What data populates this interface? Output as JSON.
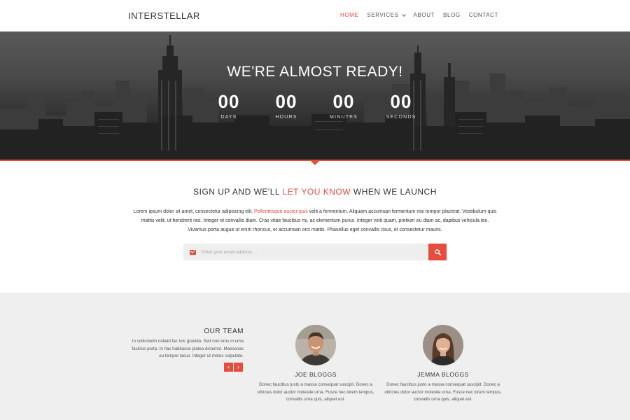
{
  "nav": {
    "brand": "INTERSTELLAR",
    "items": [
      {
        "label": "HOME",
        "active": true
      },
      {
        "label": "SERVICES",
        "has_dropdown": true
      },
      {
        "label": "ABOUT"
      },
      {
        "label": "BLOG"
      },
      {
        "label": "CONTACT"
      }
    ]
  },
  "hero": {
    "title": "WE'RE ALMOST READY!",
    "countdown": [
      {
        "value": "00",
        "label": "DAYS"
      },
      {
        "value": "00",
        "label": "HOURS"
      },
      {
        "value": "00",
        "label": "MINUTES"
      },
      {
        "value": "00",
        "label": "SECONDS"
      }
    ]
  },
  "signup": {
    "heading_before": "SIGN UP AND WE'LL ",
    "heading_highlight": "LET YOU KNOW",
    "heading_after": " WHEN WE LAUNCH",
    "body_before": "Lorem ipsum dolor sit amet, consectetur adipiscing elit. ",
    "body_link": "Pellentesque auctor quis",
    "body_after": " velit a fermentum. Aliquam accumsan fermentum nisi tempor placerat. Vestibulum quis mattis velit, ut hendrerit nisi. Integer et convallis diam. Cras vitae faucibus mi, ac elementum purus. Integer velit quam, pretium eu diam ac, dapibus vehicula leo. Vivamus porta augue ut enim rhoncus, et accumsan orci mattis. Phasellus eget convallis risus, et consectetur mauris.",
    "email_placeholder": "Enter your email address ..."
  },
  "team": {
    "title": "OUR TEAM",
    "description": "In sollicitudin nullaid fac Iuis gravida. Sed non eros in urna facilisis porta. In hac habitasse platea dictumst. Maecenas eu tempor lacus. Integer ut metus vulputate.",
    "arrow_prev": "‹",
    "arrow_next": "›",
    "members": [
      {
        "name": "JOE BLOGGS",
        "bio": "Donec faucibus justo a massa consequat suscipit. Donec a ultricies dolor auctor molestie urna. Fusce nec lorem tempus, convallis urna quis, aliquet est."
      },
      {
        "name": "JEMMA BLOGGS",
        "bio": "Donec faucibus justo a massa consequat suscipit. Donec a ultricies dolor auctor molestie urna. Fusce nec lorem tempus, convallis urna quis, aliquet est."
      }
    ]
  },
  "colors": {
    "accent": "#e74c3c",
    "team_bg": "#efefef",
    "input_bg": "#eeeeee"
  },
  "icons": {
    "email": "envelope-icon",
    "submit": "search-icon",
    "prev": "chevron-left-icon",
    "next": "chevron-right-icon"
  }
}
